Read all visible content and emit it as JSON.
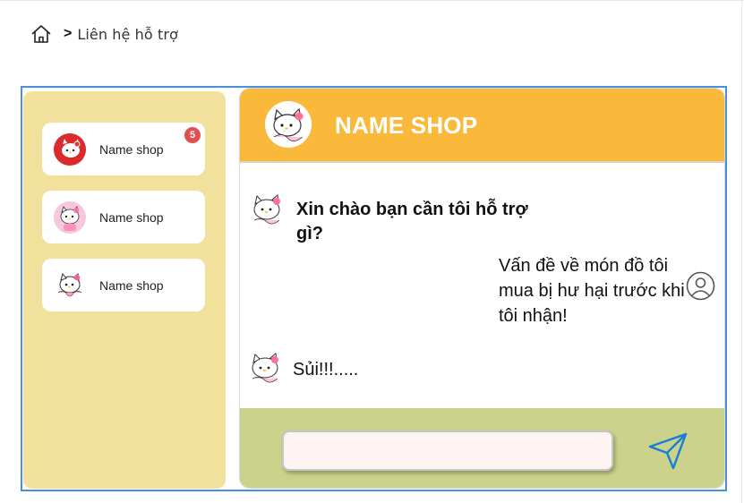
{
  "breadcrumb": {
    "home_icon": "home-icon",
    "separator": ">",
    "current": "Liên hệ hỗ trợ"
  },
  "sidebar": {
    "contacts": [
      {
        "name": "Name shop",
        "unread": "5",
        "avatar": "hello-kitty-red-avatar"
      },
      {
        "name": "Name shop",
        "avatar": "hello-kitty-pink-avatar"
      },
      {
        "name": "Name shop",
        "avatar": "hello-kitty-white-avatar"
      }
    ]
  },
  "chat": {
    "title": "NAME SHOP",
    "messages": [
      {
        "from": "shop",
        "text": "Xin chào bạn cần tôi hỗ trợ gì?"
      },
      {
        "from": "user",
        "text": "Vấn đề về món đồ tôi mua bị hư hại trước khi tôi nhận!"
      },
      {
        "from": "shop",
        "text": "Sủi!!!....."
      }
    ],
    "input_placeholder": "",
    "send_icon": "send-icon"
  },
  "colors": {
    "sidebar_bg": "#f2e19d",
    "header_bg": "#fbb93b",
    "footer_bg": "#cad28b",
    "badge": "#e05050",
    "frame_border": "#4a90e2"
  }
}
